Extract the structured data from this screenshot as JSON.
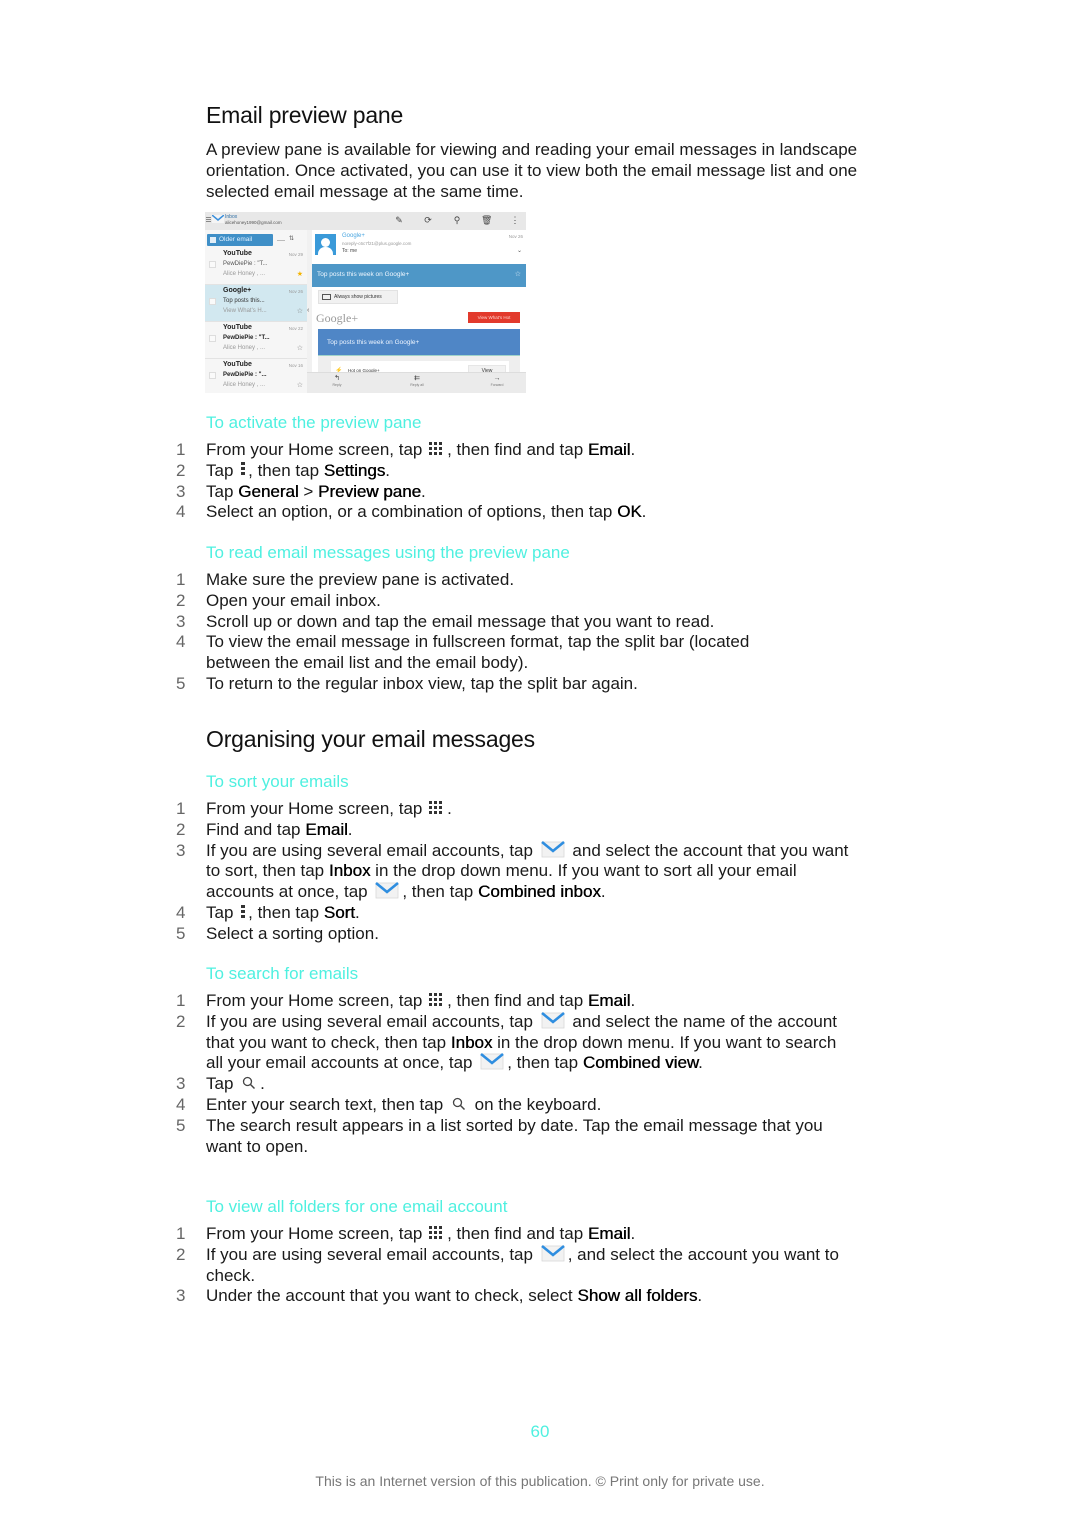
{
  "sections": {
    "preview": {
      "heading": "Email preview pane",
      "intro": "A preview pane is available for viewing and reading your email messages in landscape orientation. Once activated, you can use it to view both the email message list and one selected email message at the same time.",
      "activate": {
        "title": "To activate the preview pane",
        "steps": [
          {
            "num": "1",
            "a": "From your Home screen, tap ",
            "icon": "apps-icon",
            "b": ", then find and tap ",
            "bold": "Email",
            "c": "."
          },
          {
            "num": "2",
            "a": "Tap ",
            "icon": "menu-icon",
            "b": ", then tap ",
            "bold": "Settings",
            "c": "."
          },
          {
            "num": "3",
            "a": "Tap ",
            "bold1": "General",
            "sep": " > ",
            "bold2": "Preview pane",
            "c": "."
          },
          {
            "num": "4",
            "a": "Select an option, or a combination of options, then tap ",
            "bold": "OK",
            "c": "."
          }
        ]
      },
      "read": {
        "title": "To read email messages using the preview pane",
        "steps": [
          {
            "num": "1",
            "text": "Make sure the preview pane is activated."
          },
          {
            "num": "2",
            "text": "Open your email inbox."
          },
          {
            "num": "3",
            "text": "Scroll up or down and tap the email message that you want to read."
          },
          {
            "num": "4",
            "text": "To view the email message in fullscreen format, tap the split bar (located between the email list and the email body)."
          },
          {
            "num": "5",
            "text": "To return to the regular inbox view, tap the split bar again."
          }
        ]
      }
    },
    "organising": {
      "heading": "Organising your email messages",
      "sort": {
        "title": "To sort your emails",
        "steps": [
          {
            "num": "1",
            "a": "From your Home screen, tap ",
            "b": "."
          },
          {
            "num": "2",
            "a": "Find and tap ",
            "bold": "Email",
            "c": "."
          },
          {
            "num": "3",
            "a": "If you are using several email accounts, tap ",
            "b": " and select the account that you want to sort, then tap ",
            "bold1": "Inbox",
            "c": " in the drop down menu. If you want to sort all your email accounts at once, tap ",
            "d": ", then tap ",
            "bold2": "Combined inbox",
            "e": "."
          },
          {
            "num": "4",
            "a": "Tap ",
            "b": ", then tap ",
            "bold": "Sort",
            "c": "."
          },
          {
            "num": "5",
            "text": "Select a sorting option."
          }
        ]
      },
      "search": {
        "title": "To search for emails",
        "steps": [
          {
            "num": "1",
            "a": "From your Home screen, tap ",
            "b": ", then find and tap ",
            "bold": "Email",
            "c": "."
          },
          {
            "num": "2",
            "a": "If you are using several email accounts, tap ",
            "b": " and select the name of the account that you want to check, then tap ",
            "bold1": "Inbox",
            "c": " in the drop down menu. If you want to search all your email accounts at once, tap ",
            "d": ", then tap ",
            "bold2": "Combined view",
            "e": "."
          },
          {
            "num": "3",
            "a": "Tap ",
            "b": "."
          },
          {
            "num": "4",
            "a": "Enter your search text, then tap ",
            "b": " on the keyboard."
          },
          {
            "num": "5",
            "text": "The search result appears in a list sorted by date. Tap the email message that you want to open."
          }
        ]
      },
      "folders": {
        "title": "To view all folders for one email account",
        "steps": [
          {
            "num": "1",
            "a": "From your Home screen, tap ",
            "b": ", then find and tap ",
            "bold": "Email",
            "c": "."
          },
          {
            "num": "2",
            "a": "If you are using several email accounts, tap ",
            "b": ", and select the account you want to check."
          },
          {
            "num": "3",
            "a": "Under the account that you want to check, select ",
            "bold": "Show all folders",
            "c": "."
          }
        ]
      }
    }
  },
  "screenshot": {
    "topbar": {
      "folder": "Inbox",
      "account": "alicehoney1990@gmail.com"
    },
    "list": {
      "older_label": "Older email",
      "items": [
        {
          "from": "YouTube",
          "date": "Nov 29",
          "subject": "PewDiePie : \"T...",
          "snippet": "Alice Honey , ...",
          "starred": true,
          "selected": false,
          "bold": false
        },
        {
          "from": "Google+",
          "date": "Nov 26",
          "subject": "Top posts this...",
          "snippet": "View What's H...",
          "starred": false,
          "selected": true,
          "bold": false
        },
        {
          "from": "YouTube",
          "date": "Nov 22",
          "subject": "PewDiePie : \"T...",
          "snippet": "Alice Honey , ...",
          "starred": false,
          "selected": false,
          "bold": true
        },
        {
          "from": "YouTube",
          "date": "Nov 16",
          "subject": "PewDiePie : \"...",
          "snippet": "Alice Honey , ...",
          "starred": false,
          "selected": false,
          "bold": true
        }
      ]
    },
    "message": {
      "sender": "Google+",
      "address": "noreply-c6c7f21@plus.google.com",
      "to": "To: me",
      "date": "Nov 26",
      "subject": "Top posts this week on Google+",
      "show_pictures": "Always show pictures",
      "google_logo": "Google+",
      "hot_button": "View What's Hot",
      "banner": "Top posts this week on Google+",
      "card_title": "Hot on Google+",
      "card_view": "View"
    },
    "bottom_actions": [
      {
        "label": "Reply",
        "icon": "↰"
      },
      {
        "label": "Reply all",
        "icon": "⇇"
      },
      {
        "label": "Forward",
        "icon": "→"
      }
    ]
  },
  "footer": {
    "page_number": "60",
    "notice": "This is an Internet version of this publication. © Print only for private use."
  },
  "colors": {
    "procedure_title": "#4ff0e0",
    "accent_blue": "#4e97c7",
    "hot_red": "#e23a2c"
  }
}
